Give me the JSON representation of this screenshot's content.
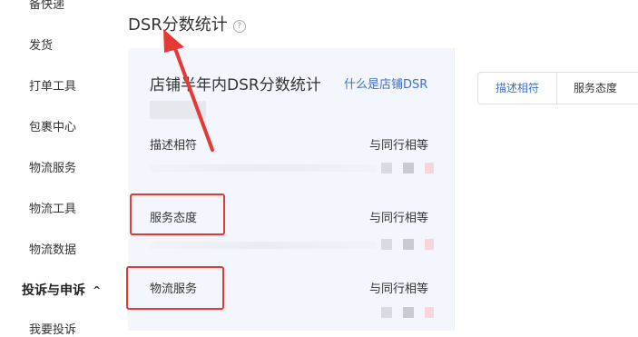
{
  "sidebar": {
    "items": [
      {
        "label": "备快递"
      },
      {
        "label": "发货"
      },
      {
        "label": "打单工具"
      },
      {
        "label": "包裹中心"
      },
      {
        "label": "物流服务"
      },
      {
        "label": "物流工具"
      },
      {
        "label": "物流数据"
      }
    ],
    "group": {
      "label": "投诉与申诉",
      "caret": "^"
    },
    "group_items": [
      {
        "label": "我要投诉"
      }
    ]
  },
  "page": {
    "title": "DSR分数统计",
    "help_icon": "question-circle-icon"
  },
  "dsr_card": {
    "title": "店铺半年内DSR分数统计",
    "link": "什么是店铺DSR",
    "rows": [
      {
        "label": "描述相符",
        "value": "与同行相等"
      },
      {
        "label": "服务态度",
        "value": "与同行相等"
      },
      {
        "label": "物流服务",
        "value": "与同行相等"
      }
    ]
  },
  "tabs": [
    {
      "label": "描述相符",
      "active": true
    },
    {
      "label": "服务态度",
      "active": false
    }
  ],
  "colors": {
    "annotation_red": "#e53935",
    "link_blue": "#3f6fc9",
    "card_bg": "#f3f6fc"
  }
}
